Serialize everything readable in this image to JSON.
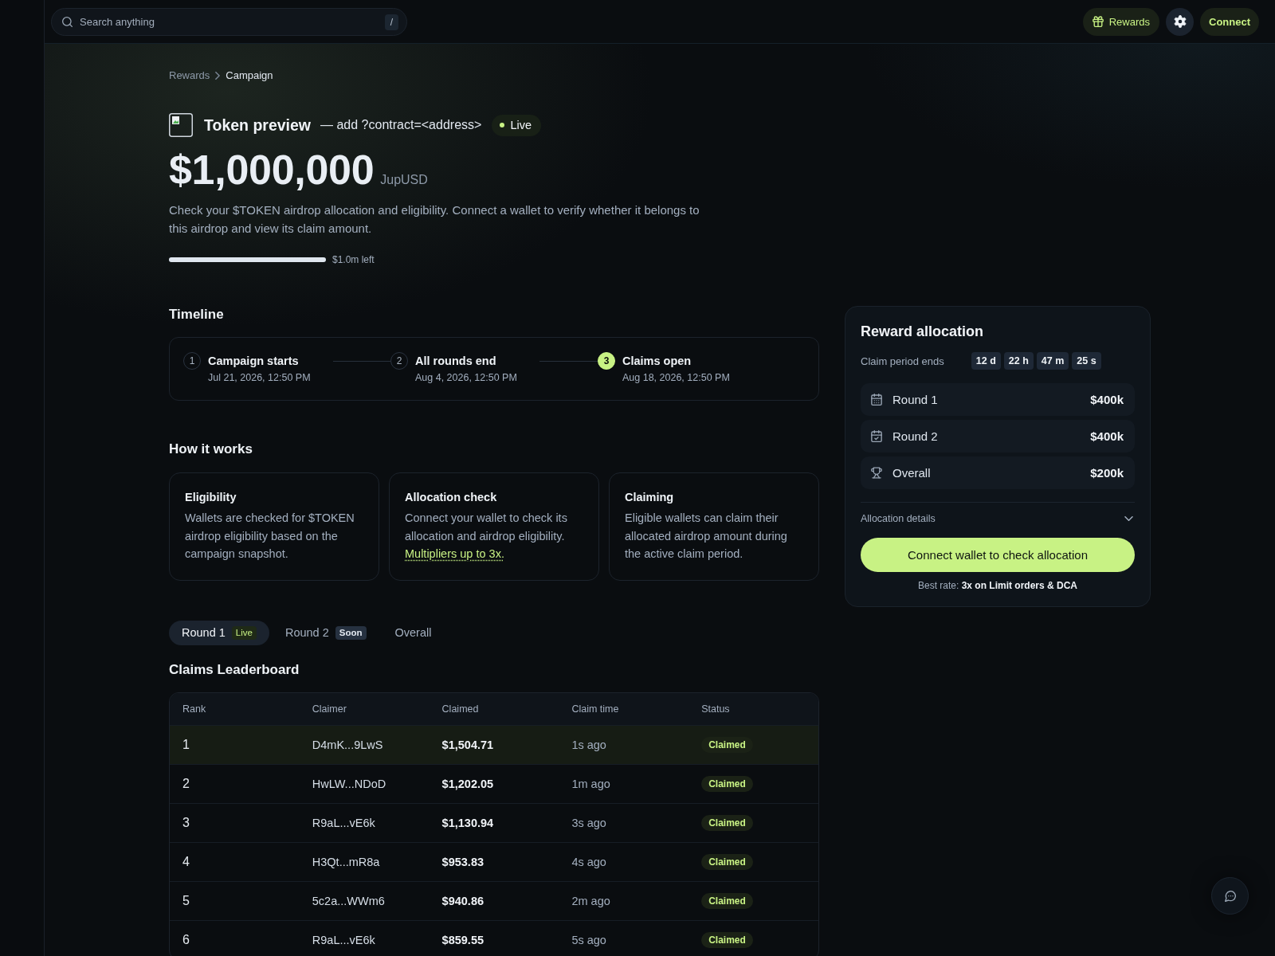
{
  "topbar": {
    "search": {
      "placeholder": "Search anything",
      "shortcut": "/"
    },
    "rewards_button": "Rewards",
    "connect_button": "Connect"
  },
  "breadcrumb": [
    {
      "label": "Rewards",
      "current": false
    },
    {
      "label": "Campaign",
      "current": true
    }
  ],
  "header": {
    "title": "Token preview",
    "hint": "— add ?contract=<address>",
    "status": "Live",
    "amount": "$1,000,000",
    "currency": "JupUSD",
    "description": "Check your $TOKEN airdrop allocation and eligibility. Connect a wallet to verify whether it belongs to this airdrop and view its claim amount.",
    "progress": {
      "level": 1,
      "reading": "$1.0m left"
    }
  },
  "timeline": {
    "title": "Timeline",
    "steps": [
      {
        "number": "1",
        "title": "Campaign starts",
        "date": "Jul 21, 2026, 12:50 PM",
        "active": false
      },
      {
        "number": "2",
        "title": "All rounds end",
        "date": "Aug 4, 2026, 12:50 PM",
        "active": false
      },
      {
        "number": "3",
        "title": "Claims open",
        "date": "Aug 18, 2026, 12:50 PM",
        "active": true
      }
    ]
  },
  "how_it_works": {
    "title": "How it works",
    "cards": [
      {
        "title": "Eligibility",
        "text": "Wallets are checked for $TOKEN airdrop eligibility based on the campaign snapshot."
      },
      {
        "title": "Allocation check",
        "text": "Connect your wallet to check its allocation and airdrop eligibility.",
        "link": "Multipliers up to 3x."
      },
      {
        "title": "Claiming",
        "text": "Eligible wallets can claim their allocated airdrop amount during the active claim period."
      }
    ]
  },
  "tabs": [
    {
      "label": "Round 1",
      "badge": {
        "text": "Live",
        "kind": "live"
      },
      "selected": true
    },
    {
      "label": "Round 2",
      "badge": {
        "text": "Soon",
        "kind": "soon"
      },
      "selected": false
    },
    {
      "label": "Overall",
      "selected": false
    }
  ],
  "leaderboard": {
    "title": "Claims Leaderboard",
    "columns": [
      "Rank",
      "Claimer",
      "Claimed",
      "Claim time",
      "Status"
    ],
    "rows": [
      {
        "rank": "1",
        "claimer": "D4mK...9LwS",
        "claimed": "$1,504.71",
        "time": "1s ago",
        "status": "Claimed",
        "highlighted": true
      },
      {
        "rank": "2",
        "claimer": "HwLW...NDoD",
        "claimed": "$1,202.05",
        "time": "1m ago",
        "status": "Claimed",
        "highlighted": false
      },
      {
        "rank": "3",
        "claimer": "R9aL...vE6k",
        "claimed": "$1,130.94",
        "time": "3s ago",
        "status": "Claimed",
        "highlighted": false
      },
      {
        "rank": "4",
        "claimer": "H3Qt...mR8a",
        "claimed": "$953.83",
        "time": "4s ago",
        "status": "Claimed",
        "highlighted": false
      },
      {
        "rank": "5",
        "claimer": "5c2a...WWm6",
        "claimed": "$940.86",
        "time": "2m ago",
        "status": "Claimed",
        "highlighted": false
      },
      {
        "rank": "6",
        "claimer": "R9aL...vE6k",
        "claimed": "$859.55",
        "time": "5s ago",
        "status": "Claimed",
        "highlighted": false
      }
    ]
  },
  "allocation": {
    "title": "Reward allocation",
    "countdown_label": "Claim period ends",
    "countdown": [
      "12 d",
      "22 h",
      "47 m",
      "25 s"
    ],
    "rows": [
      {
        "label": "Round 1",
        "amount": "$400k"
      },
      {
        "label": "Round 2",
        "amount": "$400k"
      },
      {
        "label": "Overall",
        "amount": "$200k"
      }
    ],
    "details": {
      "label": "Allocation details",
      "expanded": false
    },
    "button": "Connect wallet to check allocation",
    "note": "Best rate: **3x on Limit orders & DCA**"
  }
}
